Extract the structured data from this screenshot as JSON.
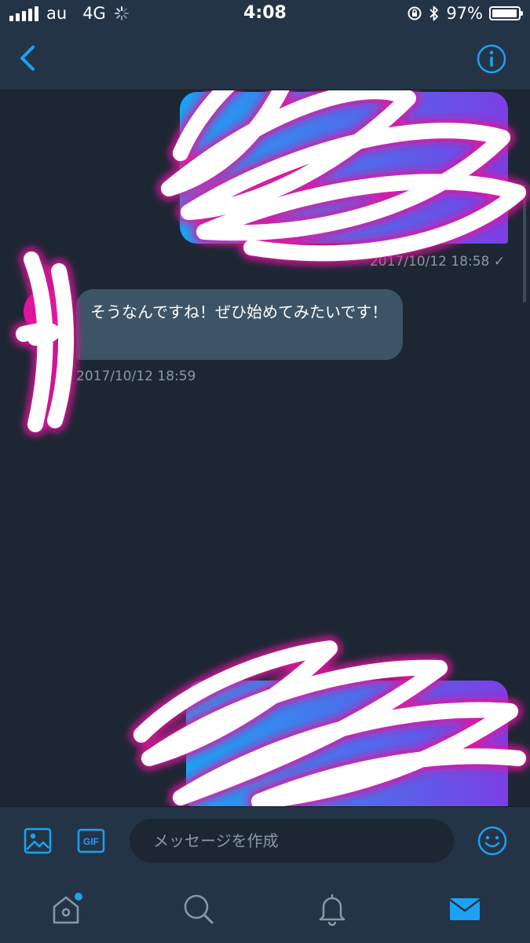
{
  "status_bar": {
    "carrier": "au",
    "network": "4G",
    "time": "4:08",
    "battery_percent": "97%",
    "battery_level": 0.97
  },
  "nav": {
    "back_icon": "chevron-left-icon",
    "info_icon": "info-icon"
  },
  "messages": [
    {
      "direction": "outgoing",
      "text": "",
      "timestamp": "2017/10/12 18:58 ✓"
    },
    {
      "direction": "incoming",
      "text": "そうなんですね！ぜひ始めてみたいです！",
      "timestamp": "2017/10/12 18:59"
    },
    {
      "direction": "outgoing",
      "text": "",
      "timestamp": ""
    }
  ],
  "composer": {
    "image_icon": "image-icon",
    "gif_label": "GIF",
    "placeholder": "メッセージを作成",
    "emoji_icon": "smiley-icon"
  },
  "tab_bar": {
    "items": [
      "home-icon",
      "search-icon",
      "bell-icon",
      "mail-icon"
    ],
    "active": "mail-icon"
  },
  "colors": {
    "background": "#1c2733",
    "bar": "#243447",
    "accent": "#1da1f2",
    "incoming_bubble": "#3d5466",
    "meta_text": "#8899a6",
    "scribble_glow": "#e0169e"
  }
}
